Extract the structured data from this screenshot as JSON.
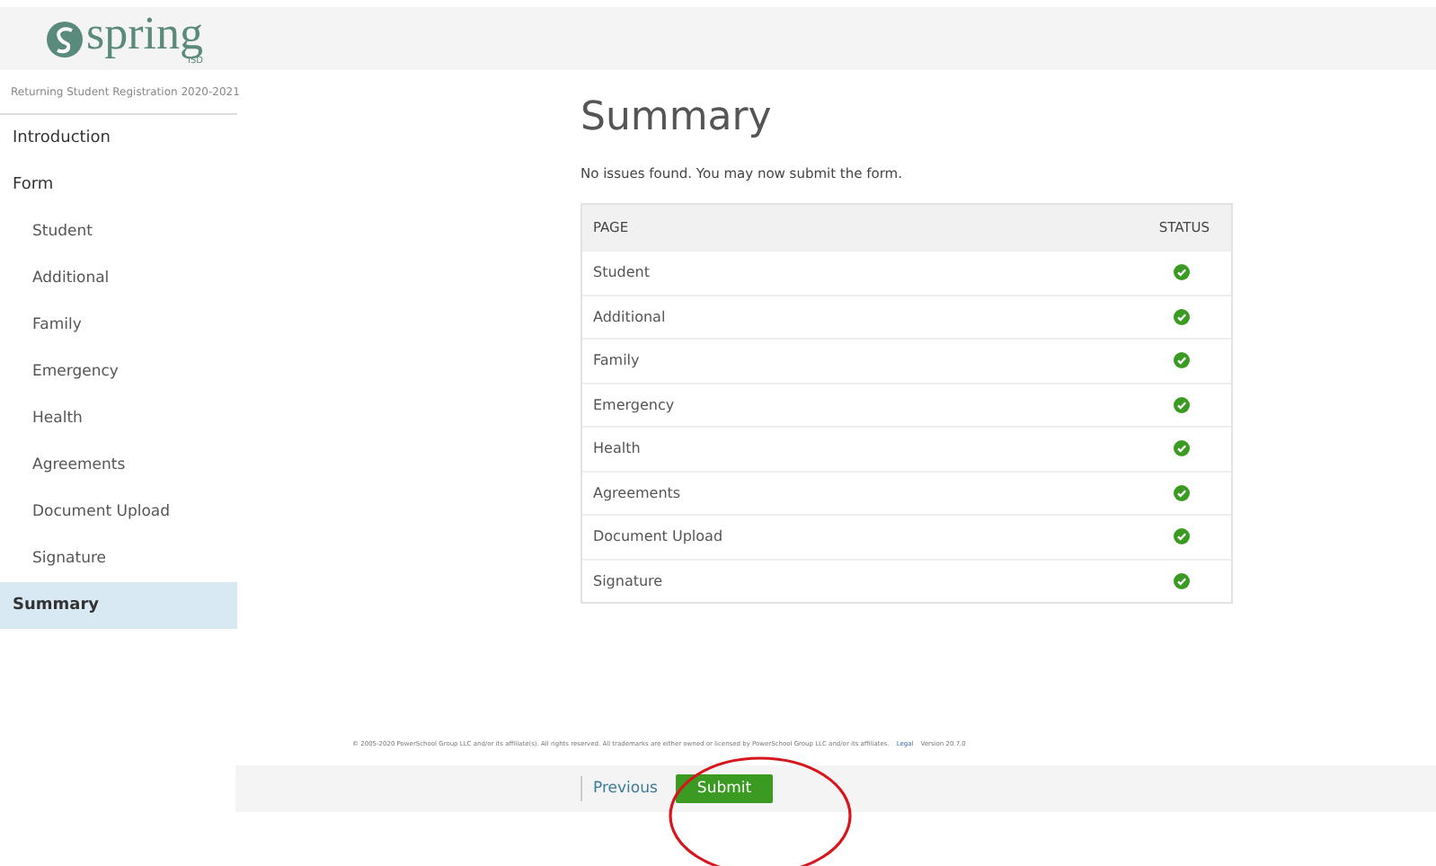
{
  "header": {
    "logo_text": "spring",
    "logo_sub": "ISD"
  },
  "sidebar": {
    "subtitle": "Returning Student Registration 2020-2021",
    "items": [
      {
        "label": "Introduction",
        "kind": "section",
        "selected": false
      },
      {
        "label": "Form",
        "kind": "section",
        "selected": false
      },
      {
        "label": "Student",
        "kind": "page",
        "selected": false
      },
      {
        "label": "Additional",
        "kind": "page",
        "selected": false
      },
      {
        "label": "Family",
        "kind": "page",
        "selected": false
      },
      {
        "label": "Emergency",
        "kind": "page",
        "selected": false
      },
      {
        "label": "Health",
        "kind": "page",
        "selected": false
      },
      {
        "label": "Agreements",
        "kind": "page",
        "selected": false
      },
      {
        "label": "Document Upload",
        "kind": "page",
        "selected": false
      },
      {
        "label": "Signature",
        "kind": "page",
        "selected": false
      },
      {
        "label": "Summary",
        "kind": "section",
        "selected": true
      }
    ]
  },
  "main": {
    "title": "Summary",
    "message": "No issues found. You may now submit the form.",
    "table": {
      "columns": [
        "PAGE",
        "STATUS"
      ],
      "rows": [
        {
          "page": "Student",
          "complete": true
        },
        {
          "page": "Additional",
          "complete": true
        },
        {
          "page": "Family",
          "complete": true
        },
        {
          "page": "Emergency",
          "complete": true
        },
        {
          "page": "Health",
          "complete": true
        },
        {
          "page": "Agreements",
          "complete": true
        },
        {
          "page": "Document Upload",
          "complete": true
        },
        {
          "page": "Signature",
          "complete": true
        }
      ]
    }
  },
  "footer": {
    "copyright": "© 2005-2020 PowerSchool Group LLC and/or its affiliate(s). All rights reserved. All trademarks are either owned or licensed by PowerSchool Group LLC and/or its affiliates.",
    "legal_link": "Legal",
    "version": "Version 20.7.0"
  },
  "actions": {
    "previous": "Previous",
    "submit": "Submit"
  }
}
